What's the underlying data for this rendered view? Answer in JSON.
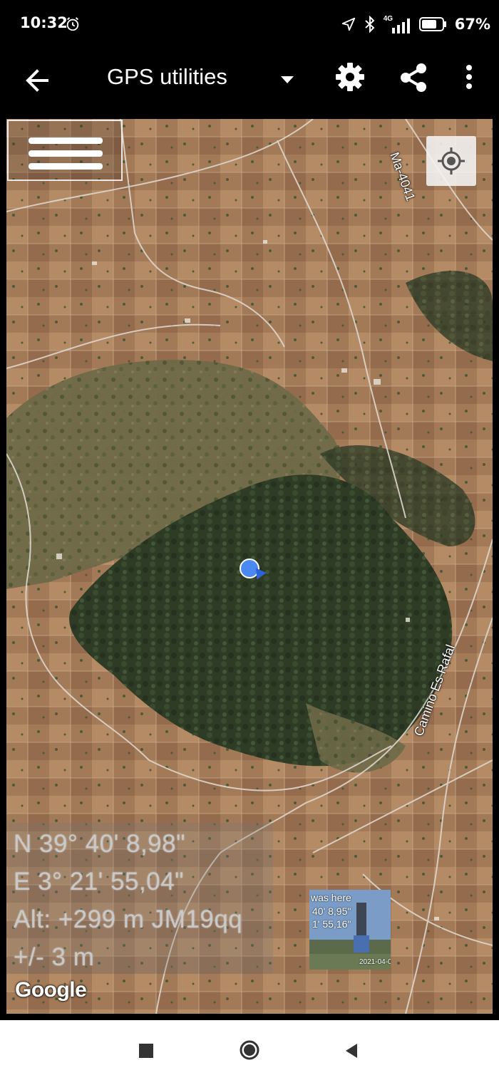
{
  "status_bar": {
    "time": "10:32",
    "network": "4G",
    "battery_percent": "67%",
    "icons": [
      "alarm-icon",
      "location-arrow-icon",
      "bluetooth-icon",
      "signal-icon",
      "battery-icon"
    ]
  },
  "app_bar": {
    "title": "GPS utilities",
    "icons": [
      "back-arrow-icon",
      "dropdown-icon",
      "gear-icon",
      "share-icon",
      "more-vert-icon"
    ]
  },
  "map": {
    "road_labels": [
      "Ma-4041",
      "Camino Es Rafal"
    ],
    "coordinates": {
      "lat": "N 39° 40' 8,98\"",
      "lon": "E 3° 21' 55,04\"",
      "alt": "Alt: +299 m JM19qq",
      "accuracy": "+/- 3 m"
    },
    "photo_thumbnail": {
      "caption": "was here",
      "lat_fragment": "40' 8,95\"",
      "lon_fragment": "1' 55,16\"",
      "date": "2021-04-0"
    },
    "attribution": "Google"
  },
  "nav_bar": {
    "icons": [
      "recent-apps-icon",
      "home-icon",
      "back-icon"
    ]
  }
}
